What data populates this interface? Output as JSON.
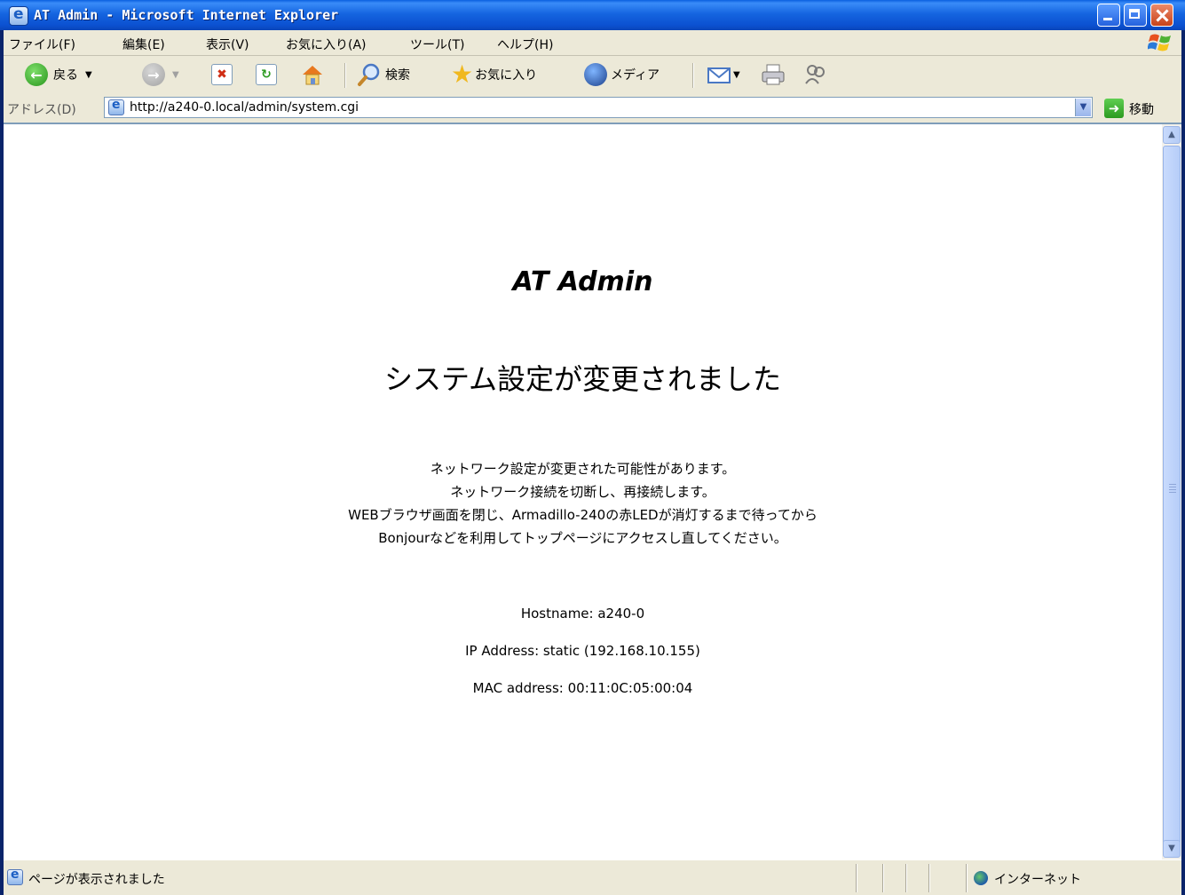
{
  "window": {
    "title": "AT Admin - Microsoft Internet Explorer"
  },
  "menubar": {
    "items": [
      "ファイル(F)",
      "編集(E)",
      "表示(V)",
      "お気に入り(A)",
      "ツール(T)",
      "ヘルプ(H)"
    ]
  },
  "toolbar": {
    "back_label": "戻る",
    "search_label": "検索",
    "favorites_label": "お気に入り",
    "media_label": "メディア"
  },
  "addressbar": {
    "label": "アドレス(D)",
    "url": "http://a240-0.local/admin/system.cgi",
    "go_label": "移動"
  },
  "page": {
    "title": "AT Admin",
    "heading": "システム設定が変更されました",
    "message_lines": [
      "ネットワーク設定が変更された可能性があります。",
      "ネットワーク接続を切断し、再接続します。",
      "WEBブラウザ画面を閉じ、Armadillo-240の赤LEDが消灯するまで待ってから",
      "Bonjourなどを利用してトップページにアクセスし直してください。"
    ],
    "hostname": "Hostname: a240-0",
    "ip_address": "IP Address: static (192.168.10.155)",
    "mac_address": "MAC address: 00:11:0C:05:00:04"
  },
  "statusbar": {
    "text": "ページが表示されました",
    "zone": "インターネット"
  }
}
